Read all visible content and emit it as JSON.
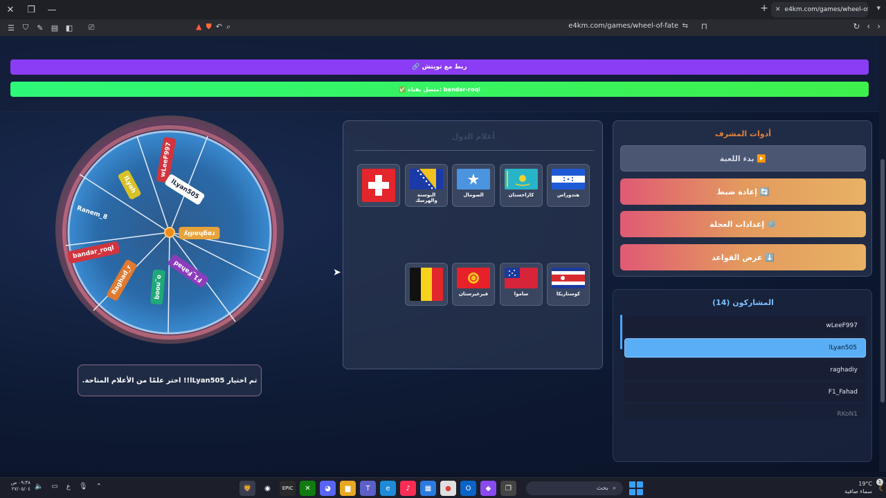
{
  "browser": {
    "tab_title": "e4km.com/games/wheel-of-fate",
    "url": "e4km.com/games/wheel-of-fate"
  },
  "header": {
    "twitch_button": "🔗 ربط مع تويتش",
    "connected_text": "✅ متصل بقناة: bandar-roql"
  },
  "wheel": {
    "labels": [
      {
        "text": "wLeeF997",
        "color": "#d2343e"
      },
      {
        "text": "lLyan505",
        "color": "#ffffff"
      },
      {
        "text": "raghadiy",
        "color": "#e8a23a"
      },
      {
        "text": "F1_Fahad",
        "color": "#8b3dbb"
      },
      {
        "text": "o_nooq",
        "color": "#1fa878"
      },
      {
        "text": "Raghad_r",
        "color": "#e07a30"
      },
      {
        "text": "bandar_roql",
        "color": "#d2343e"
      },
      {
        "text": "Ranem_8",
        "color": "transparent"
      },
      {
        "text": "lLyah",
        "color": "#d8c028"
      }
    ]
  },
  "result": {
    "text": "تم اختيار lLyan505!! اختر علمًا من الأعلام المتاحة."
  },
  "flags": {
    "title": "أعلام الدول",
    "items": [
      {
        "name": "هندوراس",
        "flag": "honduras"
      },
      {
        "name": "كازاخستان",
        "flag": "kazakhstan"
      },
      {
        "name": "الصومال",
        "flag": "somalia"
      },
      {
        "name": "البوسنة والهرسك",
        "flag": "bosnia"
      },
      {
        "name": "",
        "flag": "switzerland"
      },
      {
        "name": "كوستاريكا",
        "flag": "costarica"
      },
      {
        "name": "ساموا",
        "flag": "samoa"
      },
      {
        "name": "قيرغيزستان",
        "flag": "kyrgyzstan"
      },
      {
        "name": "",
        "flag": "belgium"
      }
    ]
  },
  "admin": {
    "title": "أدوات المشرف",
    "start": "▶️ بدء اللعبة",
    "reset": "🔄 إعادة ضبط",
    "wheel_settings": "⚙️ إعدادات العجلة",
    "rules": "⬇️ عرض القواعد"
  },
  "participants": {
    "title": "المشاركون (14)",
    "list": [
      "wLeeF997",
      "lLyan505",
      "raghadiy",
      "F1_Fahad",
      "RKoN1"
    ]
  },
  "taskbar": {
    "time": "٠٩:٣٨ ص",
    "date": "٢٧/٠٥/٠٤",
    "lang": "ع",
    "search": "بحث",
    "temp": "19°C",
    "weather": "سماء صافية"
  }
}
